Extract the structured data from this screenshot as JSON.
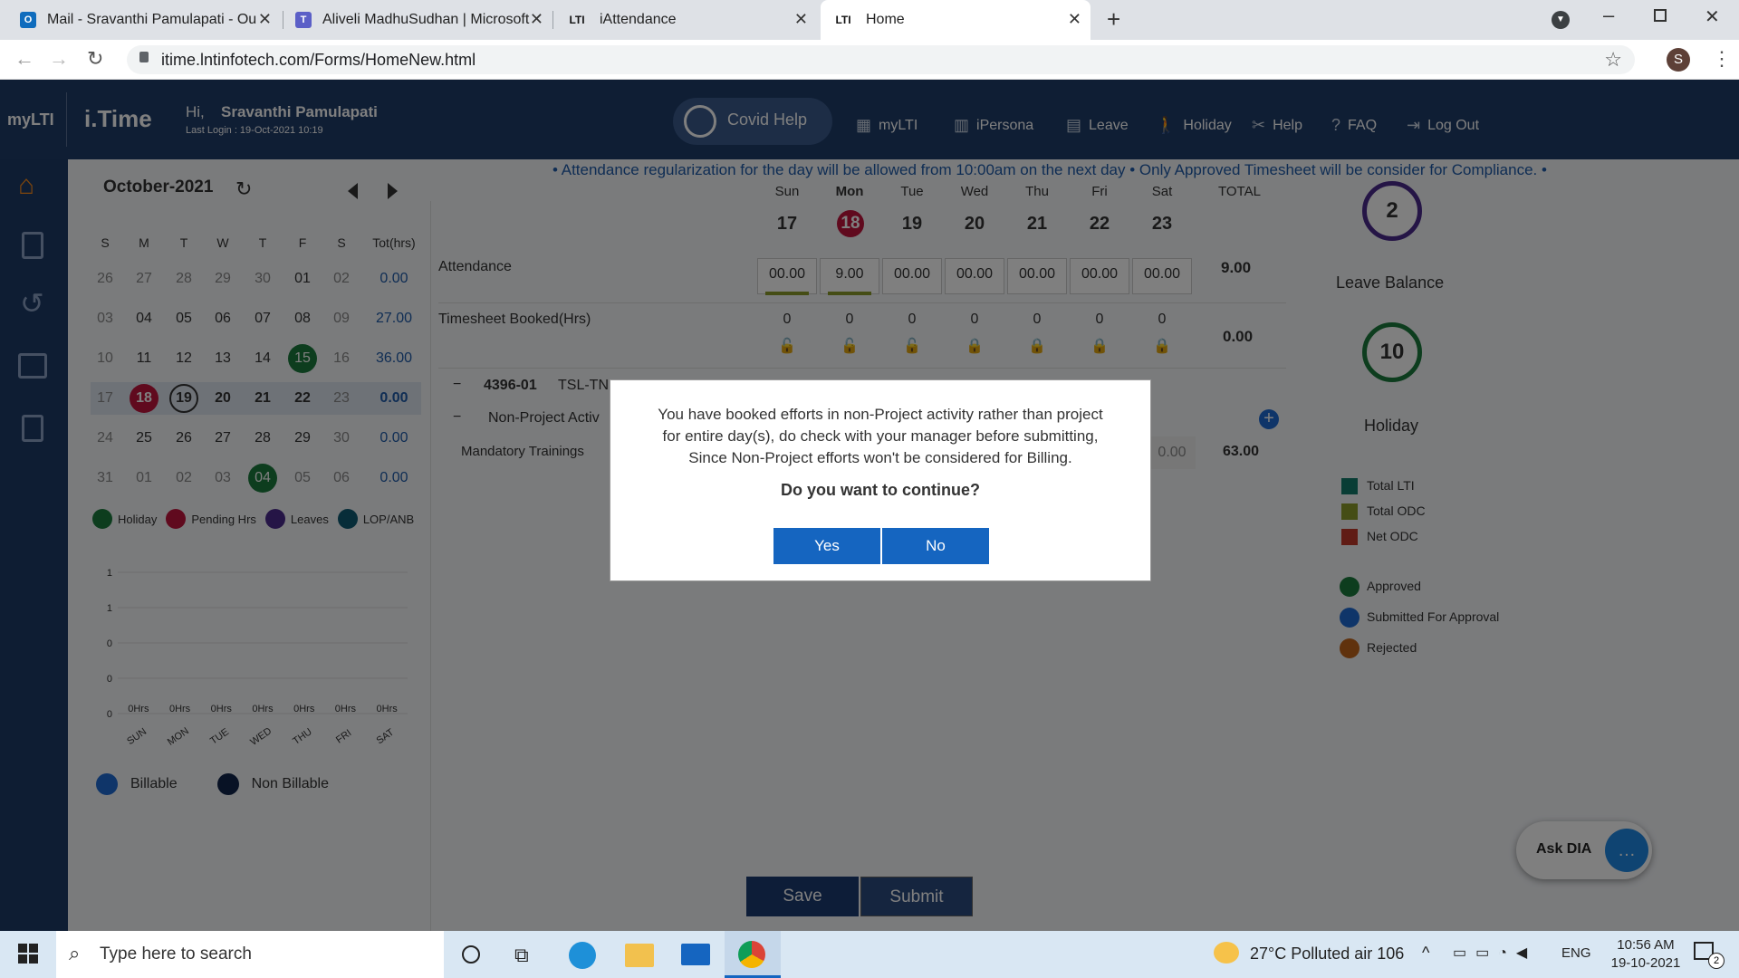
{
  "browser": {
    "tabs": [
      {
        "title": "Mail - Sravanthi Pamulapati - Ou",
        "icon": "outlook-icon",
        "color": "#0f6cbd"
      },
      {
        "title": "Aliveli MadhuSudhan | Microsoft",
        "icon": "teams-icon",
        "color": "#5b5fc7"
      },
      {
        "title": "iAttendance",
        "icon": "lti-icon",
        "color": "#222"
      },
      {
        "title": "Home",
        "icon": "lti-icon",
        "color": "#222"
      }
    ],
    "url": "itime.lntinfotech.com/Forms/HomeNew.html",
    "profile_initial": "S"
  },
  "header": {
    "brand": "myLTI",
    "app": "i.Time",
    "greeting": "Hi,",
    "user": "Sravanthi Pamulapati",
    "last_login": "Last Login :  19-Oct-2021 10:19",
    "covid": "Covid Help",
    "nav": [
      "myLTI",
      "iPersona",
      "Leave",
      "Holiday",
      "Help",
      "FAQ",
      "Log Out"
    ]
  },
  "ticker": "• Attendance regularization for the day will be allowed from 10:00am on the next day   • Only Approved Timesheet will be consider for Compliance.   •",
  "calendar": {
    "month": "October-2021",
    "dow": [
      "S",
      "M",
      "T",
      "W",
      "T",
      "F",
      "S",
      "Tot(hrs)"
    ],
    "weeks": [
      {
        "days": [
          "26",
          "27",
          "28",
          "29",
          "30",
          "01",
          "02"
        ],
        "total": "0.00"
      },
      {
        "days": [
          "03",
          "04",
          "05",
          "06",
          "07",
          "08",
          "09"
        ],
        "total": "27.00"
      },
      {
        "days": [
          "10",
          "11",
          "12",
          "13",
          "14",
          "15",
          "16"
        ],
        "total": "36.00"
      },
      {
        "days": [
          "17",
          "18",
          "19",
          "20",
          "21",
          "22",
          "23"
        ],
        "total": "0.00"
      },
      {
        "days": [
          "24",
          "25",
          "26",
          "27",
          "28",
          "29",
          "30"
        ],
        "total": "0.00"
      },
      {
        "days": [
          "31",
          "01",
          "02",
          "03",
          "04",
          "05",
          "06"
        ],
        "total": "0.00"
      }
    ],
    "legend": [
      "Holiday",
      "Pending Hrs",
      "Leaves",
      "LOP/ANB"
    ]
  },
  "chart_data": {
    "type": "bar",
    "categories": [
      "SUN",
      "MON",
      "TUE",
      "WED",
      "THU",
      "FRI",
      "SAT"
    ],
    "series": [
      {
        "name": "Billable",
        "values": [
          0,
          0,
          0,
          0,
          0,
          0,
          0
        ]
      },
      {
        "name": "Non Billable",
        "values": [
          0,
          0,
          0,
          0,
          0,
          0,
          0
        ]
      }
    ],
    "y_ticks": [
      "1",
      "1",
      "0",
      "0",
      "0"
    ],
    "data_labels": [
      "0Hrs",
      "0Hrs",
      "0Hrs",
      "0Hrs",
      "0Hrs",
      "0Hrs",
      "0Hrs"
    ],
    "legend": [
      "Billable",
      "Non Billable"
    ]
  },
  "week": {
    "days": [
      {
        "dow": "Sun",
        "date": "17",
        "att": "00.00",
        "ts": "0"
      },
      {
        "dow": "Mon",
        "date": "18",
        "att": "9.00",
        "ts": "0"
      },
      {
        "dow": "Tue",
        "date": "19",
        "att": "00.00",
        "ts": "0"
      },
      {
        "dow": "Wed",
        "date": "20",
        "att": "00.00",
        "ts": "0"
      },
      {
        "dow": "Thu",
        "date": "21",
        "att": "00.00",
        "ts": "0"
      },
      {
        "dow": "Fri",
        "date": "22",
        "att": "00.00",
        "ts": "0"
      },
      {
        "dow": "Sat",
        "date": "23",
        "att": "00.00",
        "ts": "0"
      }
    ],
    "total_label": "TOTAL",
    "attendance_label": "Attendance",
    "attendance_total": "9.00",
    "timesheet_label": "Timesheet Booked(Hrs)",
    "timesheet_total": "0.00",
    "project": "4396-01",
    "project_name": "TSL-TNI",
    "nonproject": "Non-Project Activ",
    "training": "Mandatory Trainings",
    "training_cell": "0.00",
    "training_total": "63.00"
  },
  "right": {
    "leave_count": "2",
    "leave_label": "Leave Balance",
    "holiday_count": "10",
    "holiday_label": "Holiday",
    "legend1": [
      "Total LTI",
      "Total ODC",
      "Net ODC"
    ],
    "legend2": [
      "Approved",
      "Submitted For Approval",
      "Rejected"
    ]
  },
  "modal": {
    "line1": "You have booked efforts in non-Project activity rather than project",
    "line2": "for entire day(s), do check with your manager before submitting,",
    "line3": "Since Non-Project efforts won't be considered for Billing.",
    "question": "Do you want to continue?",
    "yes": "Yes",
    "no": "No"
  },
  "actions": {
    "save": "Save",
    "submit": "Submit"
  },
  "dia": "Ask DIA",
  "taskbar": {
    "search": "Type here to search",
    "weather": "27°C  Polluted air 106",
    "lang": "ENG",
    "time": "10:56 AM",
    "date": "19-10-2021",
    "notif": "2"
  }
}
